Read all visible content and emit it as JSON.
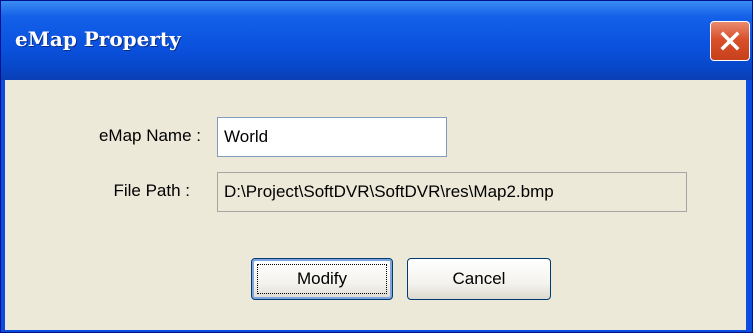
{
  "window": {
    "title": "eMap Property",
    "close_icon": "close-icon"
  },
  "form": {
    "name_label": "eMap Name :",
    "name_value": "World",
    "path_label": "File Path :",
    "path_value": "D:\\Project\\SoftDVR\\SoftDVR\\res\\Map2.bmp"
  },
  "buttons": {
    "modify_label": "Modify",
    "cancel_label": "Cancel"
  },
  "colors": {
    "titlebar": "#0a53e0",
    "close_button": "#d9512b",
    "dialog_background": "#ece9d8"
  }
}
